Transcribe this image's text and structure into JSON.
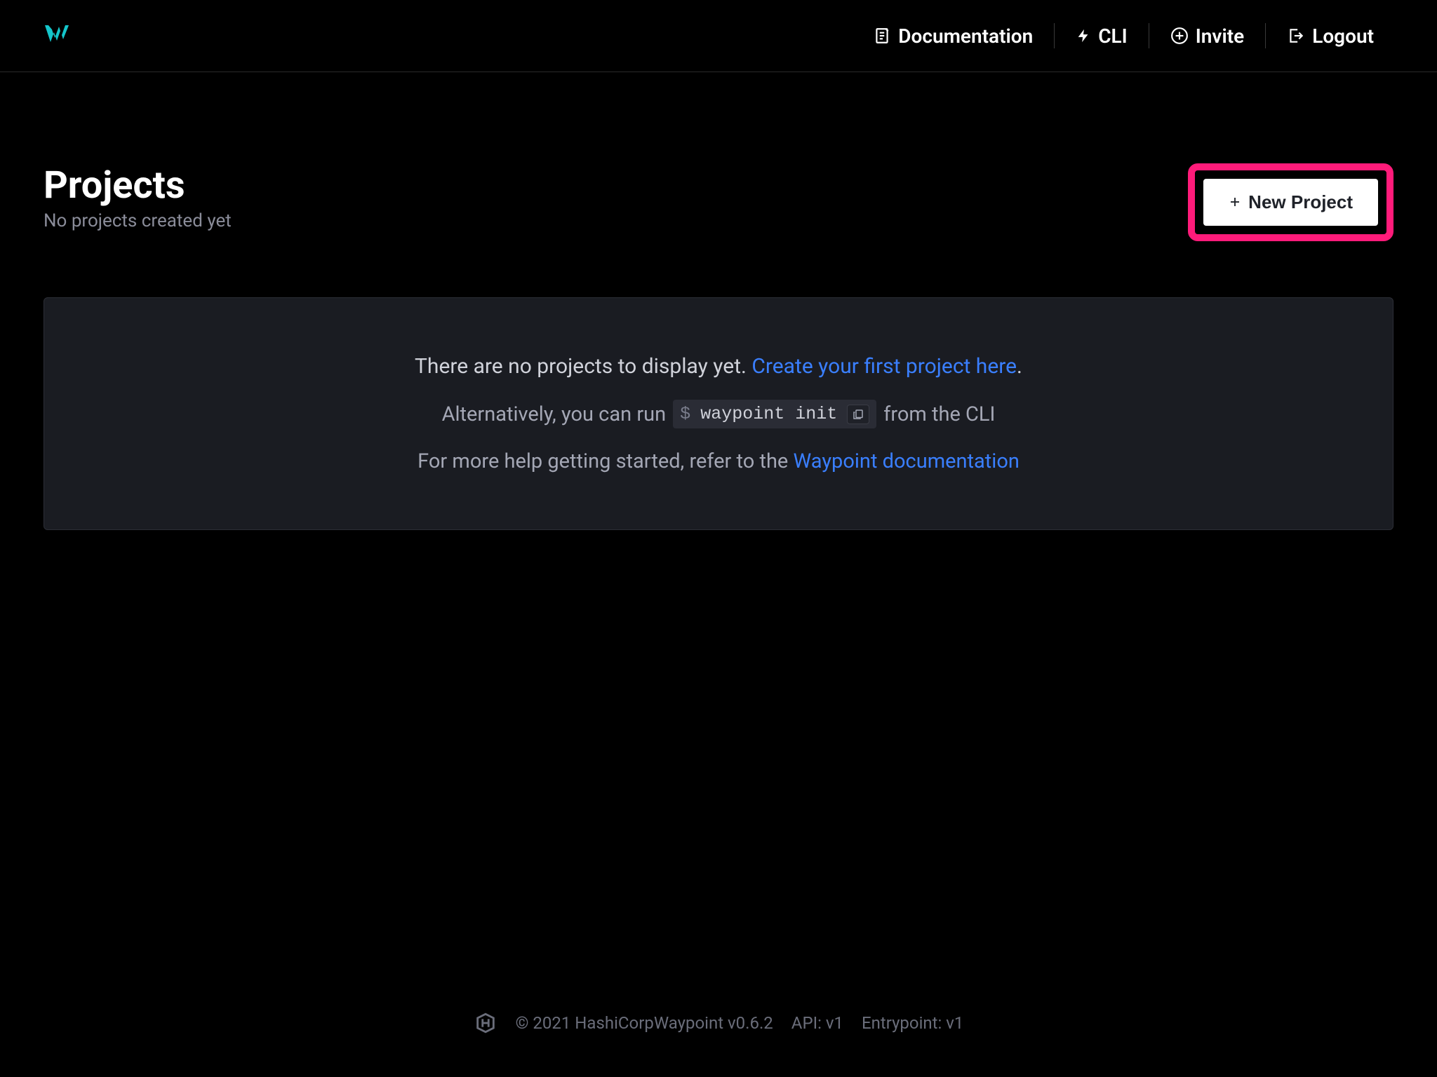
{
  "header": {
    "nav": {
      "documentation": "Documentation",
      "cli": "CLI",
      "invite": "Invite",
      "logout": "Logout"
    }
  },
  "page": {
    "title": "Projects",
    "subtitle": "No projects created yet",
    "new_project_label": "New Project"
  },
  "empty_state": {
    "line1_prefix": "There are no projects to display yet. ",
    "line1_link": "Create your first project here",
    "line1_suffix": ".",
    "line2_prefix": "Alternatively, you can run",
    "code_prompt": "$",
    "code_command": "waypoint init",
    "line2_suffix": "from the CLI",
    "line3_prefix": "For more help getting started, refer to the ",
    "line3_link": "Waypoint documentation"
  },
  "footer": {
    "copyright": "© 2021 HashiCorpWaypoint v0.6.2",
    "api": "API: v1",
    "entrypoint": "Entrypoint: v1"
  }
}
